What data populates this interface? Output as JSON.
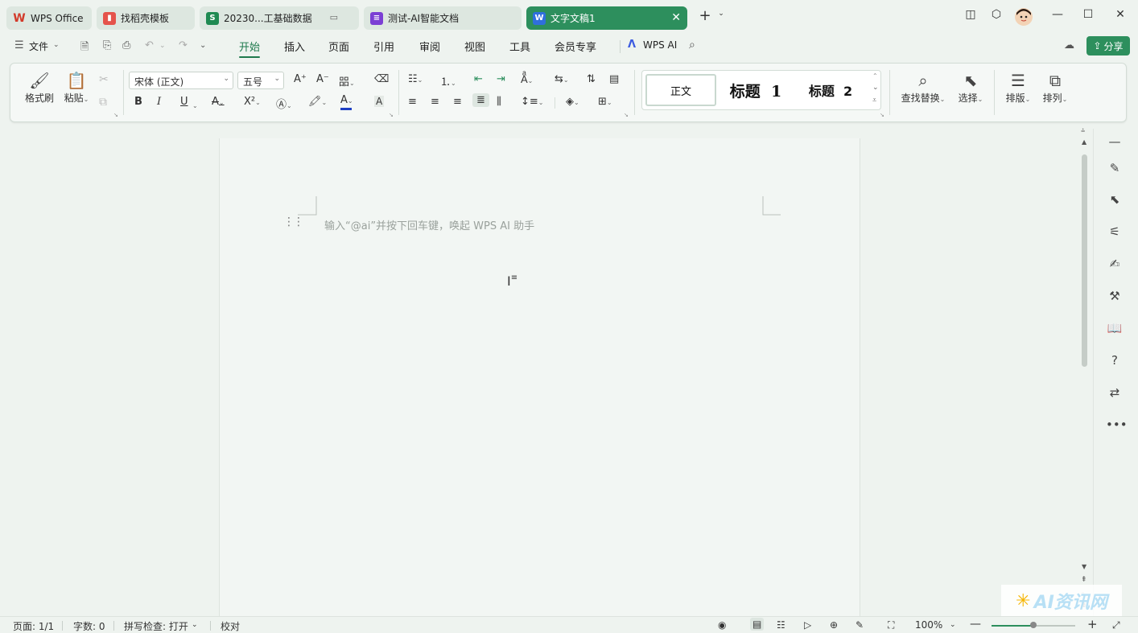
{
  "tabs": [
    {
      "label": "WPS Office",
      "icon": "W",
      "color": "#d23a2a"
    },
    {
      "label": "找稻壳模板",
      "icon": "稻",
      "color": "#e5534b"
    },
    {
      "label": "20230...工基础数据",
      "icon": "S",
      "color": "#1f8a52"
    },
    {
      "label": "测试-AI智能文档",
      "icon": "≡",
      "color": "#7b3fd4"
    },
    {
      "label": "文字文稿1",
      "icon": "W",
      "color": "#2f6fdc"
    }
  ],
  "menu": {
    "file": "文件",
    "items": [
      "开始",
      "插入",
      "页面",
      "引用",
      "审阅",
      "视图",
      "工具",
      "会员专享"
    ],
    "active": "开始",
    "wps_ai": "WPS AI",
    "share": "分享"
  },
  "ribbon": {
    "format_painter": "格式刷",
    "paste": "粘贴",
    "font_name": "宋体 (正文)",
    "font_size": "五号",
    "bold": "B",
    "italic": "I",
    "underline": "U",
    "styles": [
      "正文",
      "标题  1",
      "标题  2"
    ],
    "find_replace": "查找替换",
    "select": "选择",
    "layout": "排版",
    "arrange": "排列"
  },
  "document": {
    "placeholder": "输入“@ai”并按下回车键，唤起 WPS AI 助手"
  },
  "status": {
    "page": "页面: 1/1",
    "words": "字数: 0",
    "spell": "拼写检查: 打开",
    "proof": "校对",
    "zoom": "100%",
    "zoom_percent": 100
  },
  "watermark": "AI资讯网",
  "colors": {
    "accent": "#2d8f5d",
    "font_color_bar": "#1e3fc4"
  }
}
